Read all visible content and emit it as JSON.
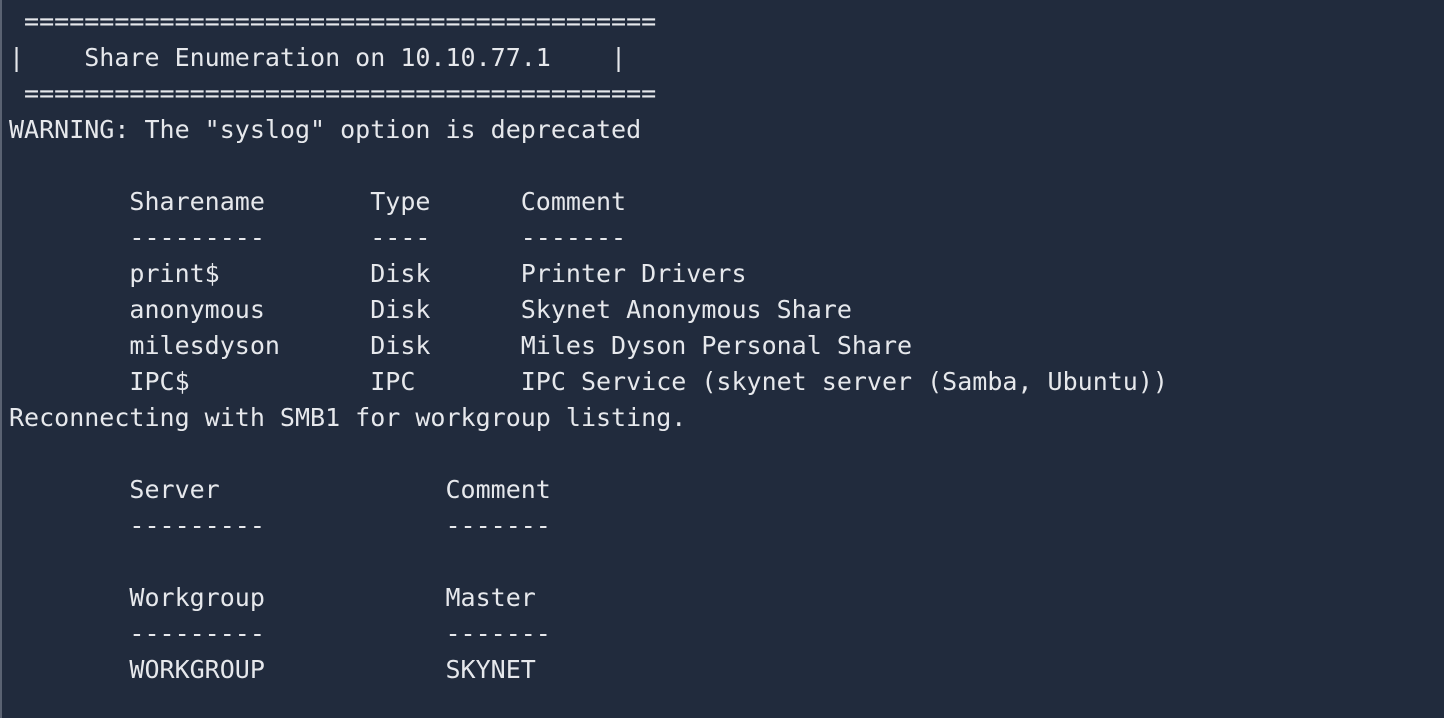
{
  "terminal": {
    "lines": [
      " ==========================================",
      "|    Share Enumeration on 10.10.77.1    |",
      " ==========================================",
      "WARNING: The \"syslog\" option is deprecated",
      "",
      "        Sharename       Type      Comment",
      "        ---------       ----      -------",
      "        print$          Disk      Printer Drivers",
      "        anonymous       Disk      Skynet Anonymous Share",
      "        milesdyson      Disk      Miles Dyson Personal Share",
      "        IPC$            IPC       IPC Service (skynet server (Samba, Ubuntu))",
      "Reconnecting with SMB1 for workgroup listing.",
      "",
      "        Server               Comment",
      "        ---------            -------",
      "",
      "        Workgroup            Master",
      "        ---------            -------",
      "        WORKGROUP            SKYNET"
    ]
  }
}
